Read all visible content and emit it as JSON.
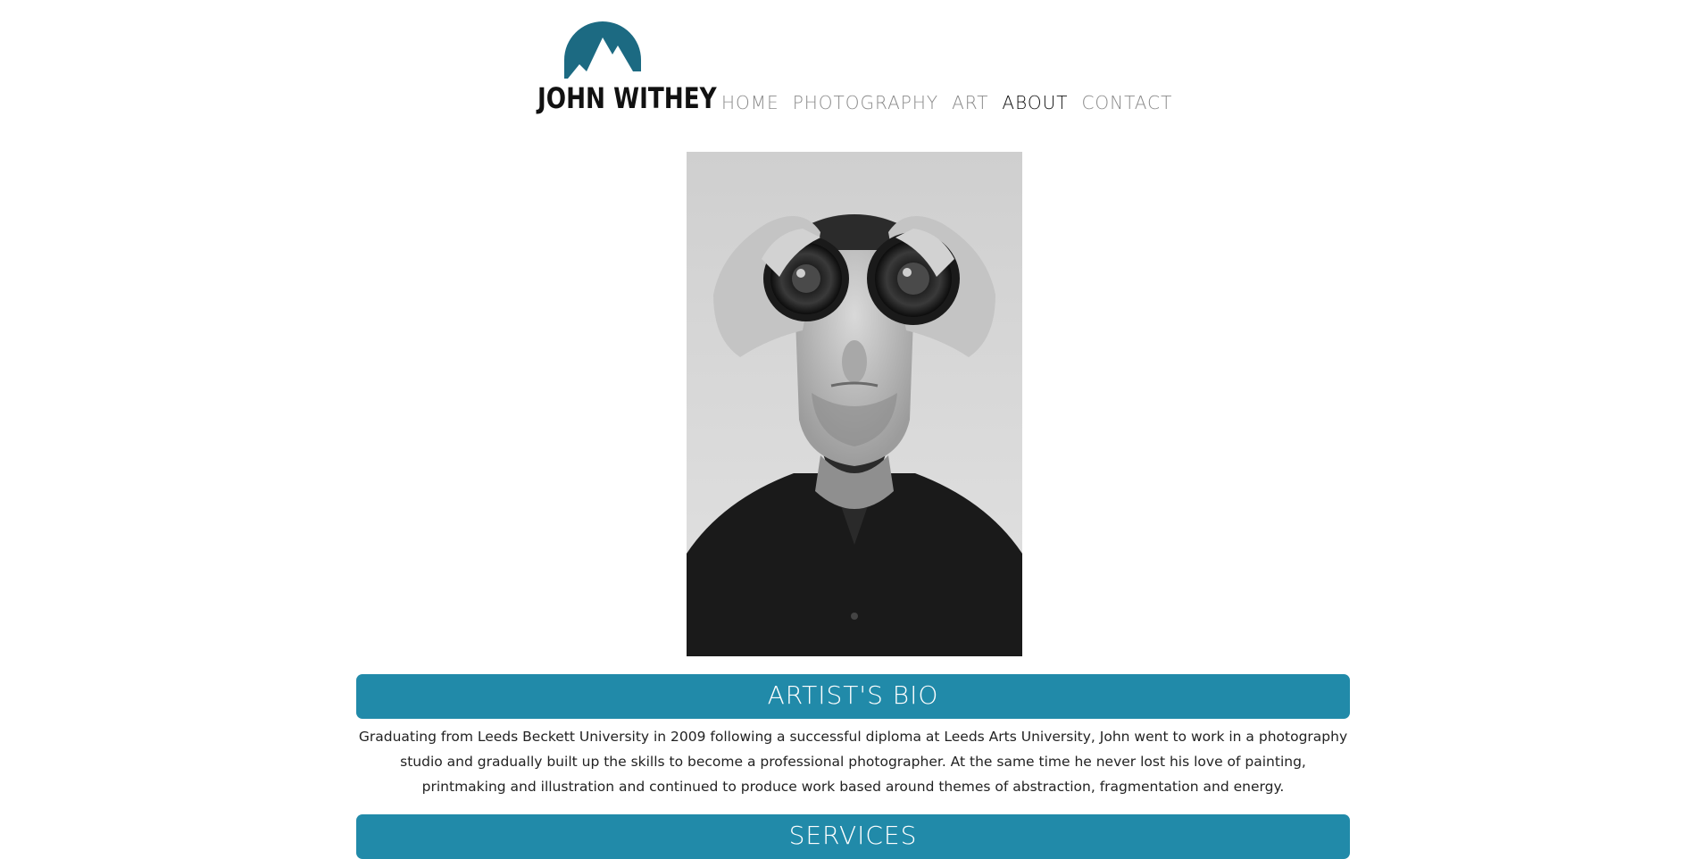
{
  "site": {
    "logo_text": "JOHN WITHEY",
    "brand_color": "#1c6a82"
  },
  "nav": {
    "items": [
      {
        "label": "HOME",
        "active": false
      },
      {
        "label": "PHOTOGRAPHY",
        "active": false
      },
      {
        "label": "ART",
        "active": false
      },
      {
        "label": "ABOUT",
        "active": true
      },
      {
        "label": "CONTACT",
        "active": false
      }
    ]
  },
  "portrait": {
    "alt": "Black and white portrait of man holding two camera lenses over his eyes like binoculars"
  },
  "bio": {
    "heading": "ARTIST'S BIO",
    "text": "Graduating from Leeds Beckett University in 2009 following a successful diploma at Leeds Arts University, John went to work in a photography studio and gradually built up the skills to become a professional photographer. At the same time he never lost his love of painting, printmaking and illustration and continued to produce work based around themes of abstraction, fragmentation and energy."
  },
  "services": {
    "heading": "SERVICES"
  },
  "colors": {
    "section_bar": "#218aa9",
    "nav_inactive": "#8a8a8a",
    "nav_active": "#111111"
  }
}
